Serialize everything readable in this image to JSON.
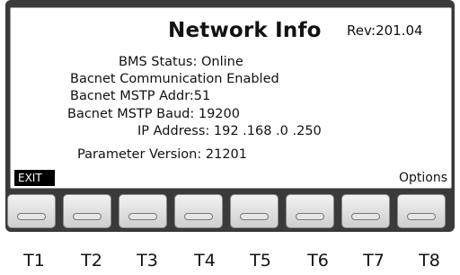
{
  "screen": {
    "title": "Network Info",
    "rev": "Rev:201.04",
    "lines": [
      "BMS Status: Online",
      "Bacnet Communication Enabled",
      "Bacnet MSTP Addr:51",
      "Bacnet MSTP Baud: 19200",
      "IP Address: 192 .168 .0 .250",
      "Parameter Version: 21201"
    ],
    "exit_label": "EXIT",
    "options_label": "Options"
  },
  "keys": [
    "T1",
    "T2",
    "T3",
    "T4",
    "T5",
    "T6",
    "T7",
    "T8"
  ]
}
